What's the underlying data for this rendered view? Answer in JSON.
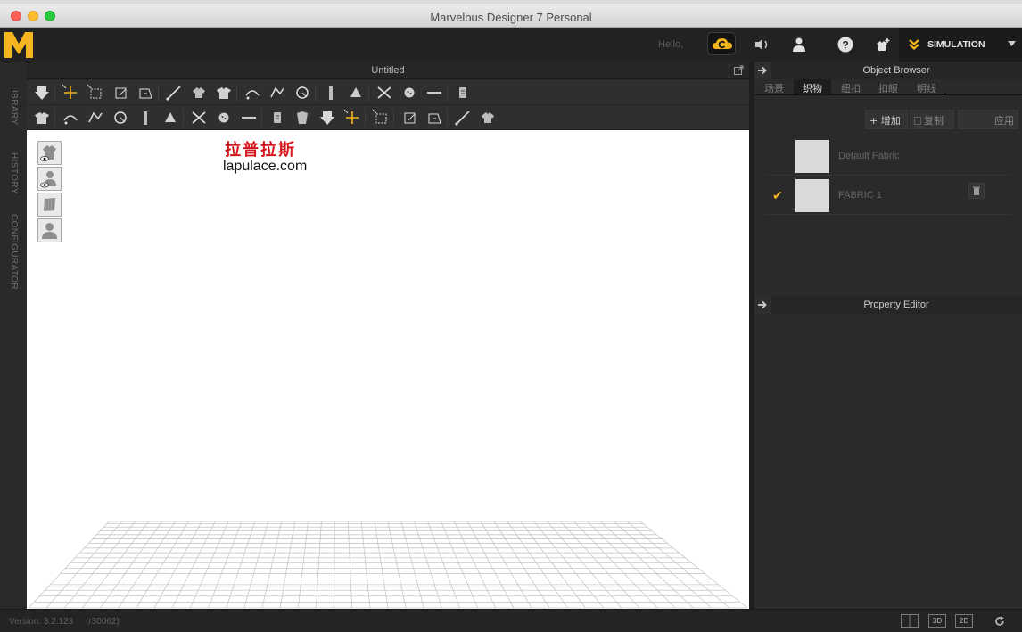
{
  "window": {
    "title": "Marvelous Designer 7 Personal"
  },
  "header": {
    "logo": "M",
    "hello": "Hello,",
    "cloud_icon": "cloud-sync-icon",
    "icons": [
      "speaker-icon",
      "user-icon",
      "help-icon",
      "fitting-icon"
    ],
    "mode_label": "SIMULATION"
  },
  "left_tabs": [
    "LIBRARY",
    "HISTORY",
    "CONFIGURATOR"
  ],
  "viewport": {
    "title": "Untitled",
    "watermark_cn": "拉普拉斯",
    "watermark_url": "lapulace.com",
    "side_buttons": [
      "show-garment",
      "show-avatar",
      "texture-view",
      "avatar-view"
    ],
    "background": "#ffffff",
    "grid_color": "#c8c8c8"
  },
  "toolbar_row1": [
    "simulate",
    "transform-pattern",
    "transform-box",
    "edit-pattern",
    "edit-curvature",
    "polygon",
    "rectangle",
    "internal-polygon",
    "fold-pattern",
    "segment-sewing",
    "free-sewing",
    "tack",
    "fold-arrangement",
    "topstitch",
    "edit-sewing",
    "edit-pin",
    "zipper"
  ],
  "toolbar_row2": [
    "avatar-pose",
    "select-mesh",
    "pin",
    "strap",
    "cut",
    "puckering",
    "arrangement",
    "button",
    "buttonhole",
    "line",
    "select-trim",
    "measure",
    "fold",
    "line-measure",
    "shrink",
    "fit",
    "layer",
    "garment-fit"
  ],
  "object_browser": {
    "title": "Object Browser",
    "tabs": [
      "场景",
      "织物",
      "纽扣",
      "扣眼",
      "明线"
    ],
    "active_tab": 1,
    "actions": {
      "add": "增加",
      "copy": "复制",
      "apply": "应用"
    },
    "fabrics": [
      {
        "name": "Default Fabric",
        "selected": false
      },
      {
        "name": "FABRIC 1",
        "selected": true
      }
    ]
  },
  "property_editor": {
    "title": "Property Editor"
  },
  "status": {
    "version": "Version: 3.2.123",
    "build": "(r30062)",
    "buttons": [
      "split-view-icon",
      "3D",
      "2D",
      "refresh-icon"
    ]
  },
  "colors": {
    "accent": "#f5b51e",
    "logo": "#f5b51e",
    "panel": "#2b2b2b"
  }
}
